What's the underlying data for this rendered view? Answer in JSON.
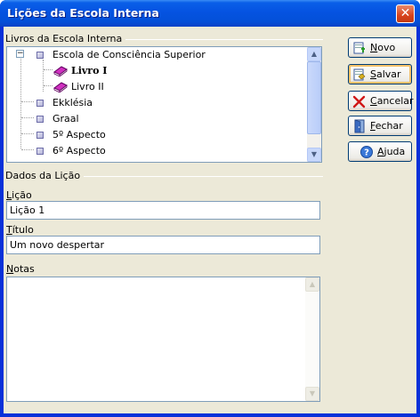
{
  "window": {
    "title": "Lições da Escola Interna",
    "close_glyph": "✕"
  },
  "books_group": {
    "label": "Livros da Escola Interna"
  },
  "tree": {
    "items": [
      {
        "label": "Escola de Consciência Superior",
        "level": 0,
        "icon": "square-node-icon",
        "expanded": true
      },
      {
        "label": "Livro I",
        "level": 1,
        "icon": "book-icon",
        "selected": true
      },
      {
        "label": "Livro II",
        "level": 1,
        "icon": "book-icon"
      },
      {
        "label": "Ekklésia",
        "level": 0,
        "icon": "square-node-icon"
      },
      {
        "label": "Graal",
        "level": 0,
        "icon": "square-node-icon"
      },
      {
        "label": "5º Aspecto",
        "level": 0,
        "icon": "square-node-icon"
      },
      {
        "label": "6º Aspecto",
        "level": 0,
        "icon": "square-node-icon"
      }
    ],
    "expander_glyph": "−"
  },
  "lesson_group": {
    "label": "Dados da Lição"
  },
  "fields": {
    "licao": {
      "label_hotkey": "L",
      "label_rest": "ição",
      "value": "Lição 1"
    },
    "titulo": {
      "label_hotkey": "T",
      "label_rest": "ítulo",
      "value": "Um novo despertar"
    },
    "notas": {
      "label_hotkey": "N",
      "label_rest": "otas",
      "value": ""
    }
  },
  "buttons": {
    "novo": {
      "hotkey": "N",
      "rest": "ovo",
      "icon": "new-document-icon"
    },
    "salvar": {
      "hotkey": "S",
      "rest": "alvar",
      "icon": "save-icon"
    },
    "cancelar": {
      "hotkey": "C",
      "rest": "ancelar",
      "icon": "cancel-icon"
    },
    "fechar": {
      "hotkey": "F",
      "rest": "echar",
      "icon": "exit-door-icon"
    },
    "ajuda": {
      "hotkey": "A",
      "rest": "juda",
      "icon": "help-icon"
    }
  },
  "colors": {
    "title_bar": "#0553e1",
    "dialog_bg": "#ece9d8",
    "border": "#7f9db9",
    "default_button_ring": "#f5c26a"
  }
}
